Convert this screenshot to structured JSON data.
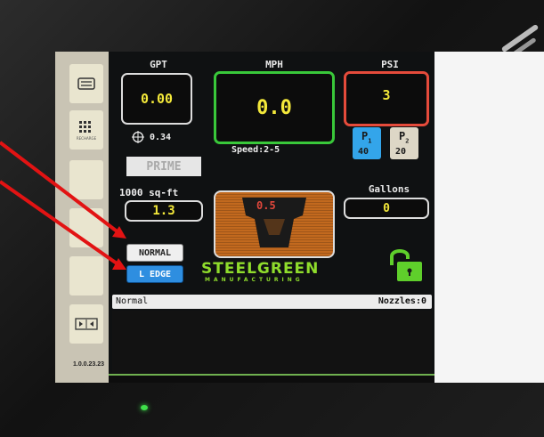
{
  "version": "1.0.0.23.23",
  "sidebar": {
    "items": [
      {
        "icon": "menu-icon"
      },
      {
        "icon": "keypad-icon",
        "sub_label": "RECHARGE"
      },
      {
        "icon": "blank"
      },
      {
        "icon": "blank"
      },
      {
        "icon": "blank"
      },
      {
        "icon": "expand-icon"
      }
    ]
  },
  "gpt": {
    "label": "GPT",
    "value": "0.00",
    "secondary": "0.34"
  },
  "mph": {
    "label": "MPH",
    "value": "0.0",
    "speed_range": "Speed:2-5"
  },
  "psi": {
    "label": "PSI",
    "value": "3"
  },
  "pressure_buttons": [
    {
      "label": "P",
      "sub": "1",
      "value": "40",
      "active": true
    },
    {
      "label": "P",
      "sub": "2",
      "value": "20",
      "active": false
    }
  ],
  "prime": {
    "label": "PRIME"
  },
  "area": {
    "label": "1000 sq-ft",
    "value": "1.3"
  },
  "center_readout": {
    "value": "0.5"
  },
  "gallons": {
    "label": "Gallons",
    "value": "0"
  },
  "modes": {
    "normal": "NORMAL",
    "edge": "L EDGE"
  },
  "brand": {
    "name": "STEELGREEN",
    "sub": "MANUFACTURING"
  },
  "status": {
    "mode": "Normal",
    "nozzles": "Nozzles:0"
  },
  "colors": {
    "mph_border": "#39c83a",
    "psi_border": "#e54b3b",
    "value_yellow": "#f3e83a",
    "brand_green": "#8fdc2c",
    "edge_blue": "#2e8ee0",
    "arrow_red": "#e21313"
  }
}
